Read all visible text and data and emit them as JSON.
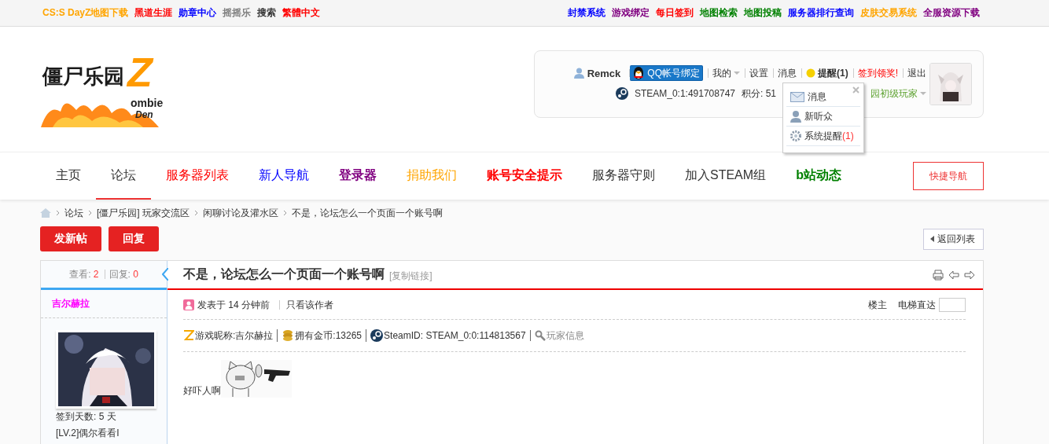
{
  "top_links_left": [
    {
      "label": "CS:S DayZ地图下载",
      "color": "#ffa500"
    },
    {
      "label": "黑道生涯",
      "color": "#ff0000"
    },
    {
      "label": "勋章中心",
      "color": "#0000ff"
    },
    {
      "label": "摇摇乐",
      "color": "#808080"
    },
    {
      "label": "搜索",
      "color": "#333333"
    },
    {
      "label": "繁體中文",
      "color": "#ff0000"
    }
  ],
  "top_links_right": [
    {
      "label": "封禁系统",
      "color": "#0000ff"
    },
    {
      "label": "游戏绑定",
      "color": "#800080"
    },
    {
      "label": "每日签到",
      "color": "#ff0000"
    },
    {
      "label": "地图检索",
      "color": "#008000"
    },
    {
      "label": "地图投稿",
      "color": "#008000"
    },
    {
      "label": "服务器排行查询",
      "color": "#0000ff"
    },
    {
      "label": "皮肤交易系统",
      "color": "#ffa500"
    },
    {
      "label": "全服资源下载",
      "color": "#800080"
    }
  ],
  "logo": {
    "main": "僵尸乐园",
    "letter": "Z",
    "word": "ombie",
    "word2": "Den"
  },
  "user_panel": {
    "username": "Remck",
    "qq_button": "QQ帐号绑定",
    "links": [
      {
        "label": "我的",
        "kind": "menu"
      },
      {
        "label": "设置",
        "kind": "link"
      },
      {
        "label": "消息",
        "kind": "link"
      },
      {
        "label": "提醒(1)",
        "kind": "notice"
      },
      {
        "label": "签到领奖!",
        "kind": "promo"
      },
      {
        "label": "退出",
        "kind": "link"
      }
    ],
    "steam_id": "STEAM_0:1:491708747",
    "points": "积分: 51",
    "group": "园初级玩家",
    "dropdown": [
      {
        "label": "消息",
        "kind": "mail"
      },
      {
        "label": "新听众",
        "kind": "user"
      },
      {
        "label": "系统提醒",
        "count": "(1)",
        "kind": "gear"
      }
    ]
  },
  "nav": [
    {
      "label": "主页",
      "color": "#333333",
      "bold": false,
      "selected": false
    },
    {
      "label": "论坛",
      "color": "#333333",
      "bold": false,
      "selected": true
    },
    {
      "label": "服务器列表",
      "color": "#ff0000",
      "bold": false,
      "selected": false
    },
    {
      "label": "新人导航",
      "color": "#0000ff",
      "bold": false,
      "selected": false
    },
    {
      "label": "登录器",
      "color": "#800080",
      "bold": true,
      "selected": false
    },
    {
      "label": "捐助我们",
      "color": "#ffa500",
      "bold": false,
      "selected": false
    },
    {
      "label": "账号安全提示",
      "color": "#ff0000",
      "bold": true,
      "selected": false
    },
    {
      "label": "服务器守则",
      "color": "#333333",
      "bold": false,
      "selected": false
    },
    {
      "label": "加入STEAM组",
      "color": "#333333",
      "bold": false,
      "selected": false
    },
    {
      "label": "b站动态",
      "color": "#008000",
      "bold": true,
      "selected": false
    }
  ],
  "quick_nav": "快捷导航",
  "breadcrumb": [
    "论坛",
    "[僵尸乐园] 玩家交流区",
    "闲聊讨论及灌水区",
    "不是，论坛怎么一个页面一个账号啊"
  ],
  "buttons": [
    "发新帖",
    "回复"
  ],
  "back_button": "返回列表",
  "stats": {
    "views_label": "查看:",
    "views": "2",
    "replies_label": "回复:",
    "replies": "0"
  },
  "thread": {
    "title": "不是，论坛怎么一个页面一个账号啊",
    "copy_link": "[复制链接]"
  },
  "author": {
    "name": "吉尔赫拉",
    "sign_days": "签到天数: 5 天",
    "level": "[LV.2]偶尔看看I"
  },
  "post": {
    "posted": "发表于 14 分钟前",
    "only_author": "只看该作者",
    "floor": "楼主",
    "jump_label": "电梯直达",
    "info": [
      {
        "kind": "z",
        "text": "游戏昵称:吉尔赫拉"
      },
      {
        "kind": "coins",
        "text": "拥有金币:13265"
      },
      {
        "kind": "steam",
        "text": "SteamID: STEAM_0:0:114813567"
      },
      {
        "kind": "search",
        "text": "玩家信息"
      }
    ],
    "body": "好吓人啊"
  }
}
